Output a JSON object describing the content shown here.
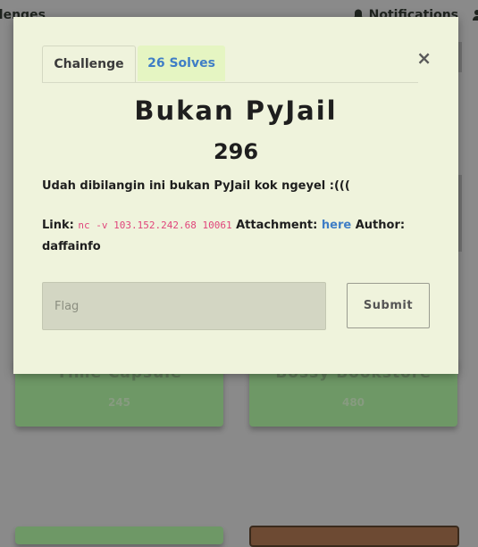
{
  "nav": {
    "left_label": "llenges",
    "notifications_label": "Notifications"
  },
  "background_cards": [
    {
      "title": "Time Capsule",
      "points": "245"
    },
    {
      "title": "Bossy Bookstore",
      "points": "480"
    }
  ],
  "modal": {
    "tabs": [
      {
        "label": "Challenge"
      },
      {
        "label": "26 Solves"
      }
    ],
    "close_glyph": "×",
    "title": "Bukan PyJail",
    "value": "296",
    "description": "Udah dibilangin ini bukan PyJail kok ngeyel :(((",
    "link_label": "Link:",
    "link_command": "nc -v 103.152.242.68 10061",
    "attachment_label": "Attachment:",
    "attachment_link": "here",
    "author_label": "Author:",
    "author_name": "daffainfo",
    "flag_placeholder": "Flag",
    "submit_label": "Submit"
  },
  "colors": {
    "modal_bg": "#eff3dc",
    "overlay": "#8a8a8a",
    "card_green": "#6e9866",
    "link_blue": "#3f7ec6",
    "code_pink": "#e0457b"
  }
}
